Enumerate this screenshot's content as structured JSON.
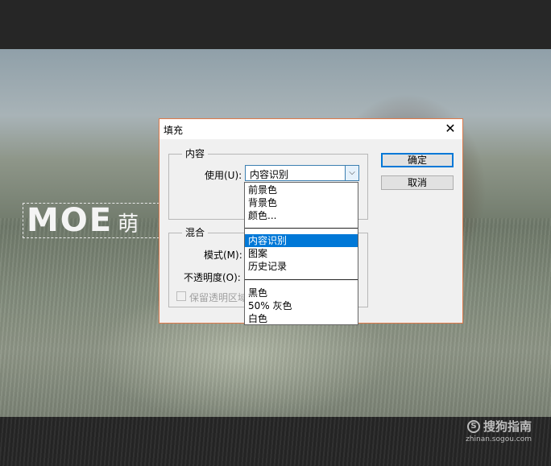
{
  "background": {
    "overlay_text_latin": "MOE",
    "overlay_text_cn": "萌"
  },
  "watermark": {
    "logo_letter": "S",
    "brand": "搜狗指南",
    "url": "zhinan.sogou.com"
  },
  "dialog": {
    "title": "填充",
    "close_icon": "close-icon",
    "accent_border": "#e07a4a",
    "content_group": {
      "label": "内容",
      "use_label": "使用(U):",
      "use_value": "内容识别"
    },
    "blend_group": {
      "label": "混合",
      "mode_label": "模式(M):",
      "opacity_label": "不透明度(O):",
      "preserve_label": "保留透明区域"
    },
    "buttons": {
      "ok": "确定",
      "cancel": "取消"
    }
  },
  "dropdown": {
    "selected_color": "#0078d7",
    "groups": [
      [
        "前景色",
        "背景色",
        "颜色..."
      ],
      [
        "内容识别",
        "图案",
        "历史记录"
      ],
      [
        "黑色",
        "50% 灰色",
        "白色"
      ]
    ],
    "selected": "内容识别"
  }
}
